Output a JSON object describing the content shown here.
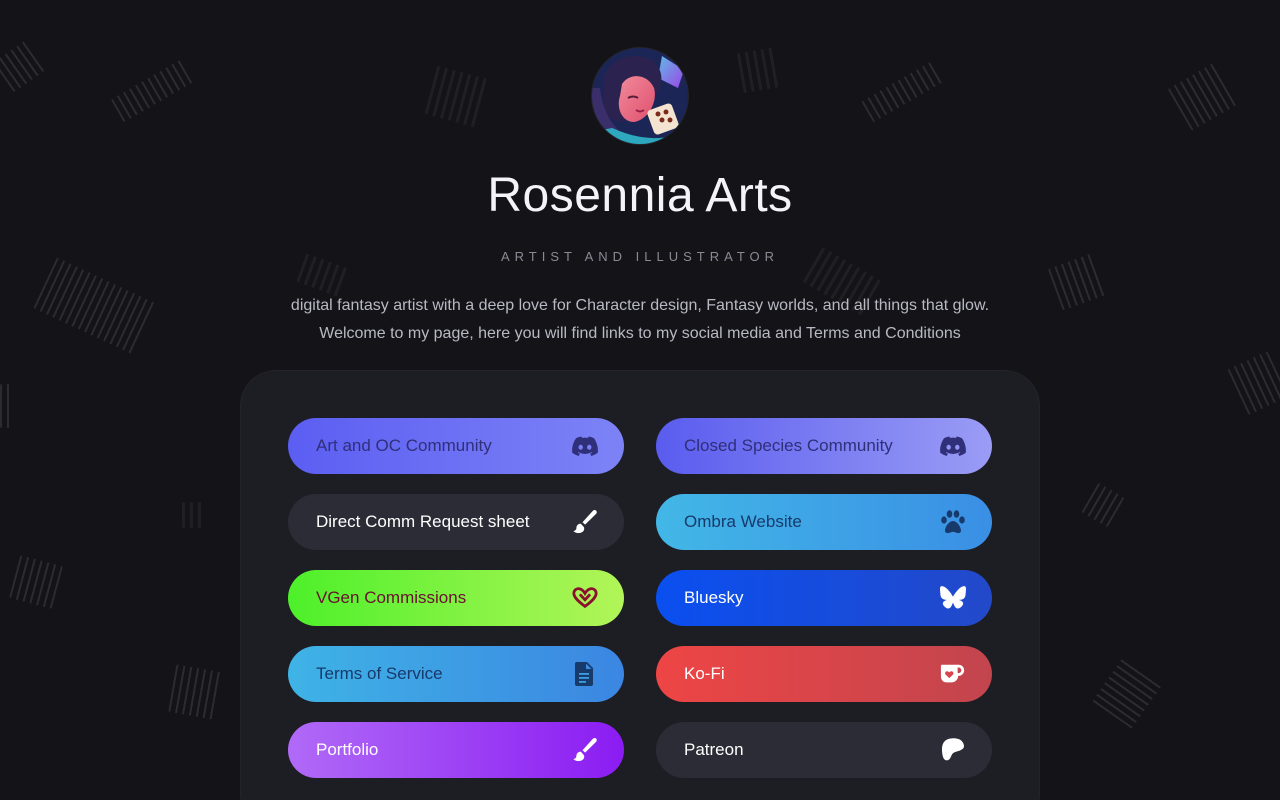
{
  "profile": {
    "name": "Rosennia Arts",
    "tagline": "ARTIST AND ILLUSTRATOR",
    "bio_lines": [
      "digital fantasy artist with a deep love for Character design, Fantasy worlds, and all things that glow.",
      "Welcome to my page, here you will find links to my social media and Terms and Conditions"
    ]
  },
  "links": [
    {
      "label": "Art and OC Community",
      "icon": "discord-icon",
      "bg": "linear-gradient(90deg,#5b5ef2,#7d83f6)",
      "text_color": "#2f2f7a",
      "icon_color": "#2f2f7a"
    },
    {
      "label": "Closed Species Community",
      "icon": "discord-icon",
      "bg": "linear-gradient(90deg,#5a5cef,#9a9cf5)",
      "text_color": "#2f2f7a",
      "icon_color": "#2f2f7a"
    },
    {
      "label": "Direct Comm Request sheet",
      "icon": "brush-icon",
      "bg": "#2c2c36",
      "text_color": "#ffffff",
      "icon_color": "#ffffff"
    },
    {
      "label": "Ombra Website",
      "icon": "paw-icon",
      "bg": "linear-gradient(90deg,#42b7e6,#3a8fe5)",
      "text_color": "#173a6b",
      "icon_color": "#173a6b"
    },
    {
      "label": "VGen Commissions",
      "icon": "vgen-icon",
      "bg": "linear-gradient(90deg,#4df02a,#b2f558)",
      "text_color": "#6a1030",
      "icon_color": "#8a1030"
    },
    {
      "label": "Bluesky",
      "icon": "butterfly-icon",
      "bg": "linear-gradient(90deg,#0a4ff0,#2349c9)",
      "text_color": "#ffffff",
      "icon_color": "#ffffff"
    },
    {
      "label": "Terms of Service",
      "icon": "document-icon",
      "bg": "linear-gradient(90deg,#3fb3e6,#3b86e2)",
      "text_color": "#173a6b",
      "icon_color": "#173a6b"
    },
    {
      "label": "Ko-Fi",
      "icon": "kofi-cup-icon",
      "bg": "linear-gradient(90deg,#ee4545,#c2454e)",
      "text_color": "#ffffff",
      "icon_color": "#ffffff"
    },
    {
      "label": "Portfolio",
      "icon": "brush-icon",
      "bg": "linear-gradient(90deg,#b06af7,#8b1cf2)",
      "text_color": "#ffffff",
      "icon_color": "#ffffff"
    },
    {
      "label": "Patreon",
      "icon": "patreon-icon",
      "bg": "#2c2c36",
      "text_color": "#ffffff",
      "icon_color": "#ffffff"
    }
  ]
}
